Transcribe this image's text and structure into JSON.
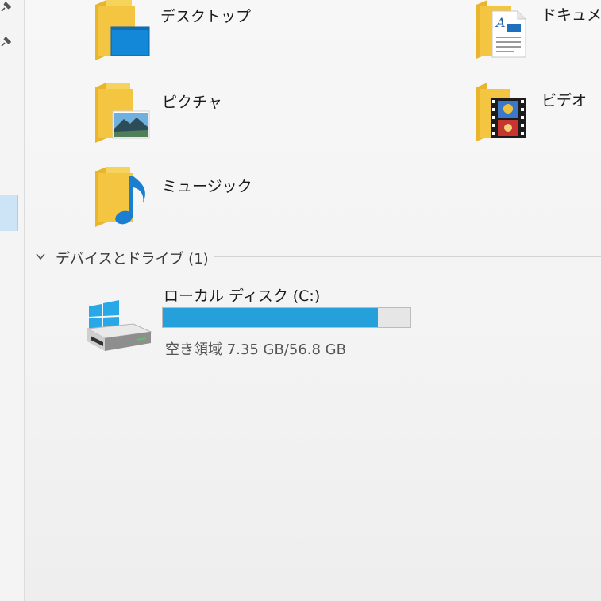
{
  "folders": {
    "desktop": {
      "label": "デスクトップ",
      "icon": "desktop-folder-icon"
    },
    "documents": {
      "label": "ドキュメン",
      "icon": "documents-folder-icon"
    },
    "pictures": {
      "label": "ピクチャ",
      "icon": "pictures-folder-icon"
    },
    "videos": {
      "label": "ビデオ",
      "icon": "videos-folder-icon"
    },
    "music": {
      "label": "ミュージック",
      "icon": "music-folder-icon"
    }
  },
  "devices_group": {
    "title": "デバイスとドライブ (1)",
    "chevron": "chevron-down-icon"
  },
  "drive": {
    "name": "ローカル ディスク (C:)",
    "free_text": "空き領域 7.35 GB/56.8 GB",
    "used_fraction": 0.87,
    "icon": "windows-drive-icon"
  },
  "colors": {
    "accent": "#26a0da",
    "folder": "#f3c540",
    "nav_selected": "#cde4f7"
  }
}
